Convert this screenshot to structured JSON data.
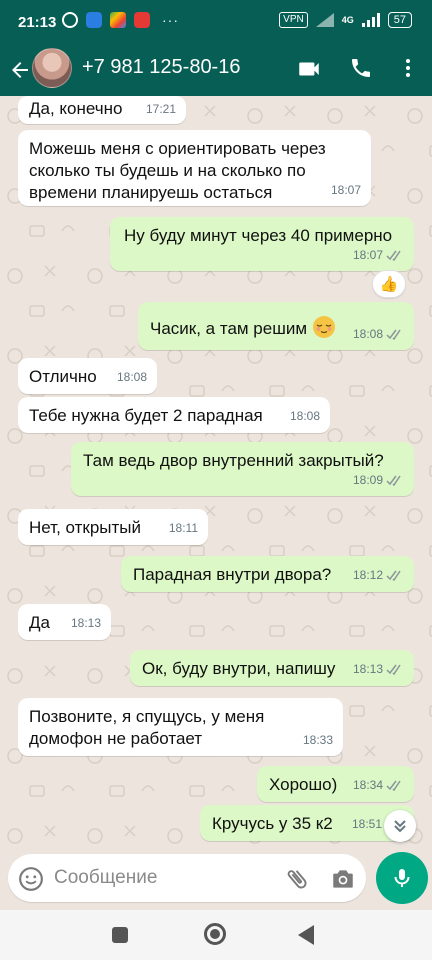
{
  "status_bar": {
    "time": "21:13",
    "dots": "···",
    "vpn": "VPN",
    "network": "4G",
    "battery": "57"
  },
  "header": {
    "contact": "+7 981 125-80-16"
  },
  "messages": [
    {
      "dir": "in",
      "text": "Да, конечно",
      "time": "17:21"
    },
    {
      "dir": "in",
      "text": "Можешь меня с ориентировать через сколько ты будешь и на сколько по времени планируешь остаться",
      "time": "18:07"
    },
    {
      "dir": "out",
      "text": "Ну буду минут через 40 примерно",
      "time": "18:07",
      "reaction": "👍"
    },
    {
      "dir": "out",
      "text": "Часик, а там решим",
      "time": "18:08"
    },
    {
      "dir": "in",
      "text": "Отлично",
      "time": "18:08"
    },
    {
      "dir": "in",
      "text": "Тебе нужна будет 2 парадная",
      "time": "18:08"
    },
    {
      "dir": "out",
      "text": "Там ведь двор внутренний закрытый?",
      "time": "18:09"
    },
    {
      "dir": "in",
      "text": "Нет, открытый",
      "time": "18:11"
    },
    {
      "dir": "out",
      "text": "Парадная внутри двора?",
      "time": "18:12"
    },
    {
      "dir": "in",
      "text": "Да",
      "time": "18:13"
    },
    {
      "dir": "out",
      "text": "Ок, буду внутри, напишу",
      "time": "18:13"
    },
    {
      "dir": "in",
      "text": "Позвоните, я спущусь, у меня домофон не работает",
      "time": "18:33"
    },
    {
      "dir": "out",
      "text": "Хорошо)",
      "time": "18:34"
    },
    {
      "dir": "out",
      "text": "Кручусь у 35 к2",
      "time": "18:51"
    }
  ],
  "composer": {
    "placeholder": "Сообщение"
  },
  "colors": {
    "header": "#075e54",
    "outgoing_bubble": "#dcf8c6",
    "incoming_bubble": "#ffffff",
    "chat_background": "#ede5dd",
    "mic_button": "#00a884"
  }
}
